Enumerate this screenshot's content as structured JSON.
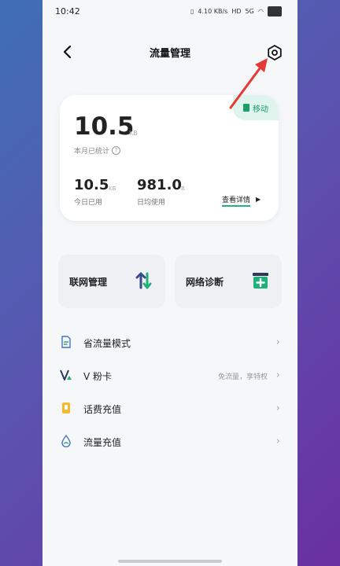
{
  "status_bar": {
    "time": "10:42",
    "network_speed": "4.10 KB/s",
    "hd_label": "HD",
    "signal_label": "5G",
    "battery": "54"
  },
  "header": {
    "title": "流量管理"
  },
  "usage_card": {
    "badge": "移动",
    "month_value": "10.5",
    "month_unit": "KB",
    "month_label": "本月已统计",
    "today_value": "10.5",
    "today_unit": "KB",
    "today_label": "今日已用",
    "daily_value": "981.0",
    "daily_unit": "B",
    "daily_label": "日均使用",
    "detail_link": "查看详情"
  },
  "tiles": [
    {
      "label": "联网管理",
      "icon": "up-down-arrows-icon"
    },
    {
      "label": "网络诊断",
      "icon": "toolbox-plus-icon"
    }
  ],
  "menu": [
    {
      "label": "省流量模式",
      "hint": "",
      "icon": "document-icon"
    },
    {
      "label": "V 粉卡",
      "hint": "免流量，享特权",
      "icon": "v-card-icon"
    },
    {
      "label": "话费充值",
      "hint": "",
      "icon": "phone-bill-icon"
    },
    {
      "label": "流量充值",
      "hint": "",
      "icon": "droplet-icon"
    }
  ],
  "colors": {
    "accent": "#20b57b",
    "red_arrow": "#e53935"
  }
}
